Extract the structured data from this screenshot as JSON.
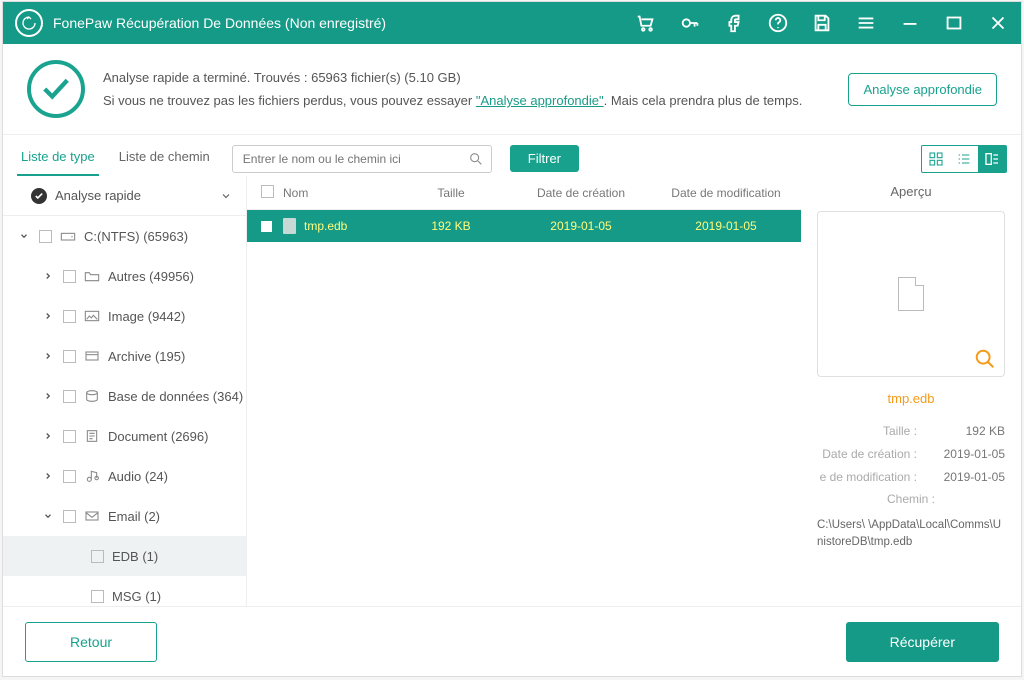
{
  "titlebar": {
    "title": "FonePaw Récupération De Données (Non enregistré)"
  },
  "status": {
    "line1": "Analyse rapide a terminé. Trouvés : 65963 fichier(s) (5.10 GB)",
    "line2a": "Si vous ne trouvez pas les fichiers perdus, vous pouvez essayer ",
    "link": "\"Analyse approfondie\"",
    "line2b": ". Mais cela prendra plus de temps.",
    "deep_scan_btn": "Analyse approfondie"
  },
  "tabs": {
    "type": "Liste de type",
    "path": "Liste de chemin"
  },
  "filter": {
    "placeholder": "Entrer le nom ou le chemin ici",
    "button": "Filtrer"
  },
  "tree": {
    "quick": "Analyse rapide",
    "drive": "C:(NTFS) (65963)",
    "items": [
      "Autres (49956)",
      "Image (9442)",
      "Archive (195)",
      "Base de données (364)",
      "Document (2696)",
      "Audio (24)",
      "Email (2)"
    ],
    "email_children": [
      "EDB (1)",
      "MSG (1)"
    ]
  },
  "table": {
    "headers": {
      "name": "Nom",
      "size": "Taille",
      "created": "Date de création",
      "modified": "Date de modification"
    },
    "row": {
      "name": "tmp.edb",
      "size": "192 KB",
      "created": "2019-01-05",
      "modified": "2019-01-05"
    }
  },
  "preview": {
    "title": "Aperçu",
    "name": "tmp.edb",
    "size_k": "Taille :",
    "size_v": "192 KB",
    "created_k": "Date de création :",
    "created_v": "2019-01-05",
    "modified_k": "e de modification :",
    "modified_v": "2019-01-05",
    "path_k": "Chemin :",
    "path_v": "C:\\Users\\        \\AppData\\Local\\Comms\\UnistoreDB\\tmp.edb"
  },
  "footer": {
    "back": "Retour",
    "recover": "Récupérer"
  }
}
